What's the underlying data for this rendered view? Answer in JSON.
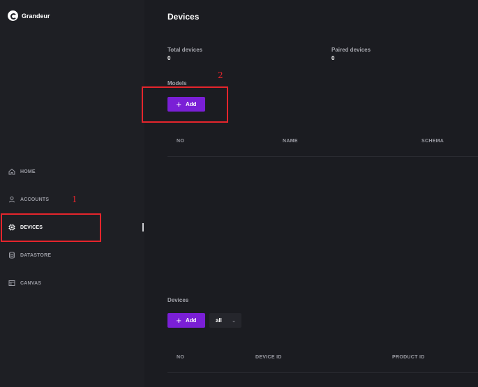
{
  "app": {
    "brand": "Grandeur"
  },
  "sidebar": {
    "items": [
      {
        "label": "HOME",
        "icon": "home-icon"
      },
      {
        "label": "ACCOUNTS",
        "icon": "user-icon"
      },
      {
        "label": "DEVICES",
        "icon": "chip-icon",
        "active": true
      },
      {
        "label": "DATASTORE",
        "icon": "database-icon"
      },
      {
        "label": "CANVAS",
        "icon": "layout-icon"
      }
    ]
  },
  "main": {
    "title": "Devices",
    "stats": {
      "total_label": "Total devices",
      "total_value": "0",
      "paired_label": "Paired devices",
      "paired_value": "0"
    },
    "models": {
      "label": "Models",
      "add_label": "Add",
      "columns": [
        "NO",
        "NAME",
        "SCHEMA"
      ]
    },
    "devices": {
      "label": "Devices",
      "add_label": "Add",
      "filter_value": "all",
      "columns": [
        "NO",
        "DEVICE ID",
        "PRODUCT ID"
      ]
    }
  },
  "annotations": {
    "one": "1",
    "two": "2"
  },
  "colors": {
    "accent": "#7a1fd6",
    "annotation": "#e5252c"
  }
}
